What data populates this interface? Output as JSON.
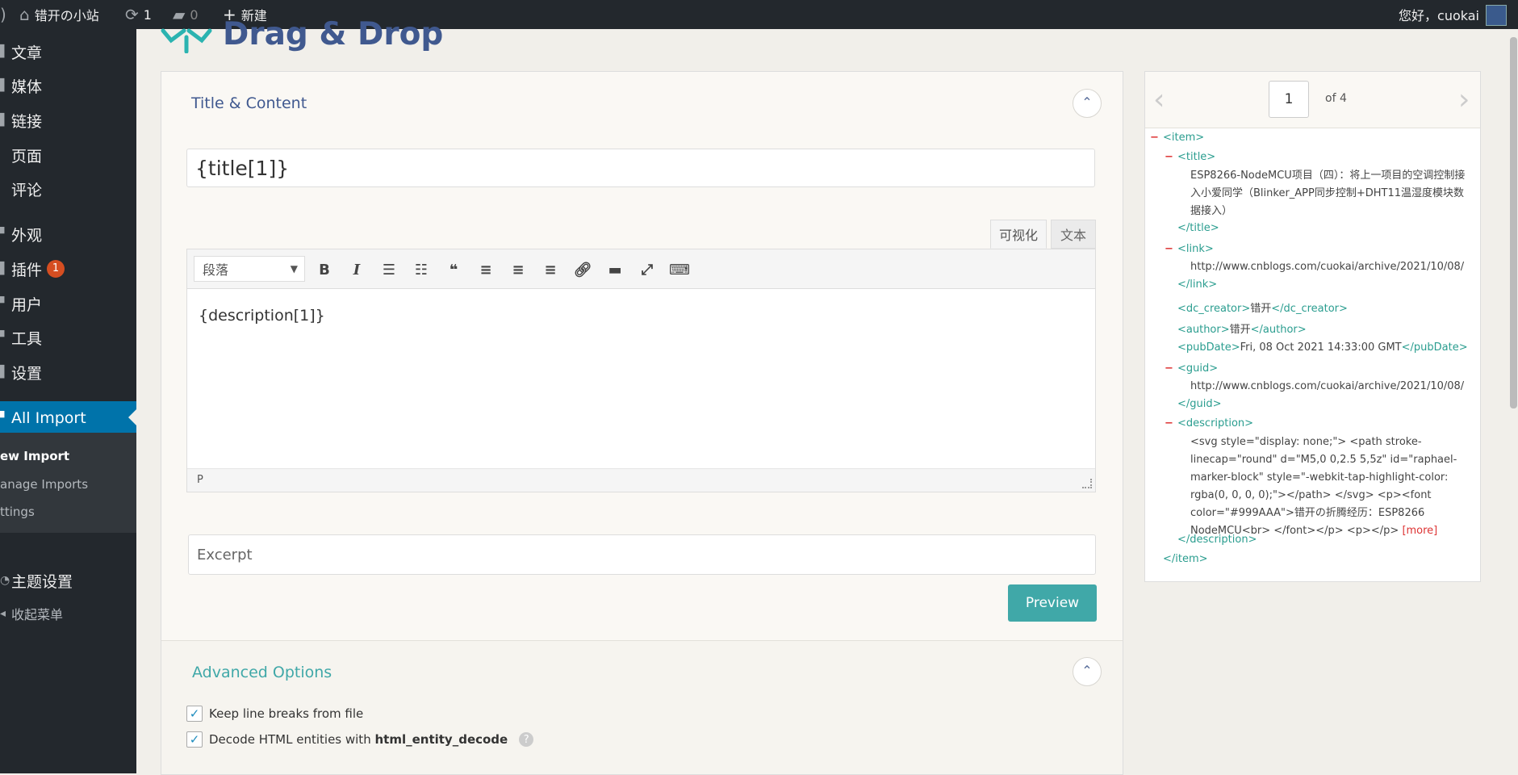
{
  "admin_bar": {
    "site_name": "错开の小站",
    "updates_count": "1",
    "comments_count": "0",
    "new_label": "新建",
    "greeting": "您好，cuokai"
  },
  "sidebar": {
    "items": [
      {
        "label": "文章"
      },
      {
        "label": "媒体"
      },
      {
        "label": "链接"
      },
      {
        "label": "页面"
      },
      {
        "label": "评论"
      },
      {
        "label": "外观"
      },
      {
        "label": "插件",
        "badge": "1"
      },
      {
        "label": "用户"
      },
      {
        "label": "工具"
      },
      {
        "label": "设置"
      },
      {
        "label": "All Import"
      },
      {
        "label": "主题设置"
      },
      {
        "label": "收起菜单"
      }
    ],
    "submenu": [
      "ew Import",
      "anage Imports",
      "ttings"
    ]
  },
  "header": {
    "title": "Drag & Drop"
  },
  "title_content": {
    "section_title": "Title & Content",
    "title_value": "{title[1]}",
    "tab_visual": "可视化",
    "tab_text": "文本",
    "format_select": "段落",
    "editor_content": "{description[1]}",
    "status_path": "P",
    "excerpt_placeholder": "Excerpt",
    "preview_label": "Preview"
  },
  "advanced": {
    "section_title": "Advanced Options",
    "option1": "Keep line breaks from file",
    "option2_prefix": "Decode HTML entities with ",
    "option2_code": "html_entity_decode",
    "help": "?"
  },
  "xml_viewer": {
    "page": "1",
    "of_label": "of 4",
    "item_open": "<item>",
    "item_close": "</item>",
    "title_open": "<title>",
    "title_text": "ESP8266-NodeMCU项目（四）：将上一项目的空调控制接入小爱同学（Blinker_APP同步控制+DHT11温湿度模块数据接入）",
    "title_close": "</title>",
    "link_open": "<link>",
    "link_text": "http://www.cnblogs.com/cuokai/archive/2021/10/08/",
    "link_close": "</link>",
    "creator_open": "<dc_creator>",
    "creator_text": "错开",
    "creator_close": "</dc_creator>",
    "author_open": "<author>",
    "author_text": "错开",
    "author_close": "</author>",
    "pubdate_open": "<pubDate>",
    "pubdate_text": "Fri, 08 Oct 2021 14:33:00 GMT",
    "pubdate_close": "</pubDate>",
    "guid_open": "<guid>",
    "guid_text": "http://www.cnblogs.com/cuokai/archive/2021/10/08/",
    "guid_close": "</guid>",
    "desc_open": "<description>",
    "desc_text": "<svg style=\"display: none;\"> <path stroke-linecap=\"round\" d=\"M5,0 0,2.5 5,5z\" id=\"raphael-marker-block\" style=\"-webkit-tap-highlight-color: rgba(0, 0, 0, 0);\"></path> </svg> <p><font color=\"#999AAA\">错开の折腾经历：ESP8266 NodeMCU<br> </font></p> <p></p>",
    "more": "[more]",
    "desc_close": "</description>"
  }
}
